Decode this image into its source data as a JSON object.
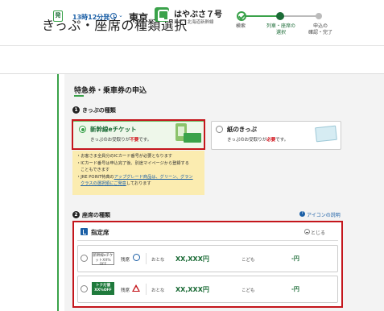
{
  "page": {
    "title": "きっぷ・座席の種類選択"
  },
  "steps": [
    {
      "label": "検索",
      "state": "done"
    },
    {
      "label": "列車・座席の\n選択",
      "state": "current"
    },
    {
      "label": "申込の\n確認・完了",
      "state": "todo"
    }
  ],
  "train": {
    "departure_badge": "発",
    "time": "13時12分発",
    "station": "東京",
    "name": "はやぶさ７号",
    "line": "東北・北海道新幹線"
  },
  "form": {
    "heading": "特急券・乗車券の申込",
    "ticket_section": {
      "number": "1",
      "title": "きっぷの種類"
    },
    "ticket_options": [
      {
        "title": "新幹線eチケット",
        "desc_prefix": "きっぷのお受取りが",
        "desc_emph": "不要",
        "desc_suffix": "です。",
        "selected": true
      },
      {
        "title": "紙のきっぷ",
        "desc_prefix": "きっぷのお受取りが",
        "desc_emph": "必要",
        "desc_suffix": "です。",
        "selected": false
      }
    ],
    "notice": {
      "line1": "・お客さま全員分のICカード番号が必要となります",
      "line2a": "・ICカード番号は申込完了後、別途マイページから登録する",
      "line2b": "こともできます",
      "line3_prefix": "・JRE POINT特典の",
      "line3_link1": "アップグレード商品は、グリーン、グラン",
      "line3_link2": "クラスの選択順にご発意",
      "line3_suffix": "しております"
    },
    "seat_section": {
      "number": "2",
      "title": "座席の種類",
      "legend_link": "アイコンの説明"
    },
    "seat_panel": {
      "title": "指定席",
      "collapse_label": "とじる",
      "rows": [
        {
          "discount": "新幹線eチケ\nットXX%\nOFF",
          "discount_style": "outline",
          "status_label": "残席",
          "status_icon": "circle",
          "adult_label": "おとな",
          "adult_price": "XX,XXX円",
          "child_label": "こども",
          "child_price": "-円"
        },
        {
          "discount": "トクだ値\nXX%OFF",
          "discount_style": "filled",
          "status_label": "残席",
          "status_icon": "triangle",
          "adult_label": "おとな",
          "adult_price": "XX,XXX円",
          "child_label": "こども",
          "child_price": "-円"
        }
      ]
    }
  },
  "colors": {
    "accent_green": "#3aa24a",
    "dark_green": "#1b6b36",
    "link_blue": "#1b5fa6",
    "alert_red": "#c4161c"
  }
}
